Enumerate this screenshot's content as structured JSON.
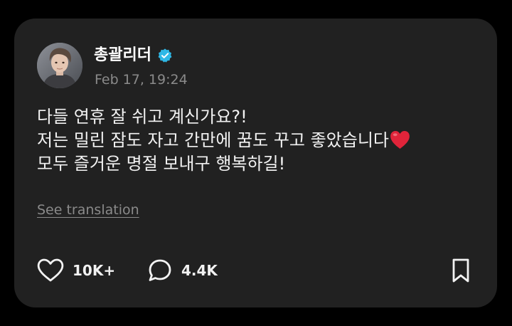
{
  "post": {
    "author": "총괄리더",
    "verified": true,
    "timestamp": "Feb 17, 19:24",
    "lines": [
      "다들 연휴 잘 쉬고 계신가요?!",
      "저는 밀린 잠도 자고 간만에 꿈도 꾸고 좋았습니다",
      "모두 즐거운 명절 보내구 행복하길!"
    ],
    "emoji": "heart-emoji",
    "translate_label": "See translation"
  },
  "actions": {
    "likes": "10K+",
    "replies": "4.4K"
  },
  "colors": {
    "background": "#000000",
    "card": "#212121",
    "text": "#f2f2f2",
    "muted": "#8a8a8a",
    "verified": "#2fb8e6",
    "heart": "#e0243a"
  }
}
